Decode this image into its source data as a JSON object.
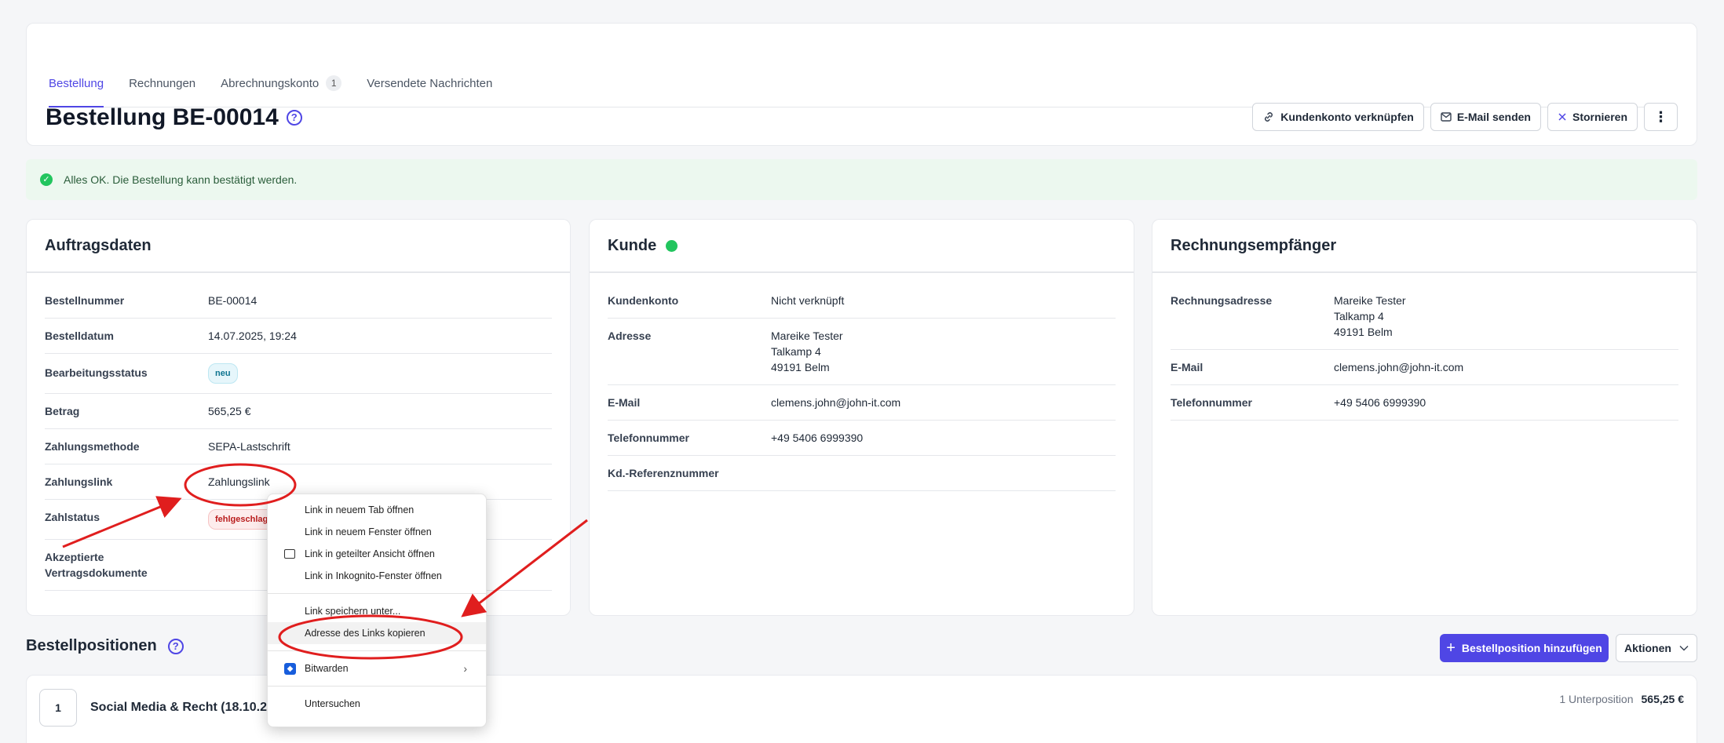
{
  "tabs": [
    {
      "label": "Bestellung"
    },
    {
      "label": "Rechnungen"
    },
    {
      "label": "Abrechnungskonto",
      "badge": "1"
    },
    {
      "label": "Versendete Nachrichten"
    }
  ],
  "header": {
    "title": "Bestellung BE-00014",
    "help": "?",
    "buttons": {
      "link": "Kundenkonto verknüpfen",
      "email": "E-Mail senden",
      "cancel": "Stornieren",
      "more": "⋮"
    }
  },
  "alert": {
    "text": "Alles OK. Die Bestellung kann bestätigt werden."
  },
  "auftrag": {
    "title": "Auftragsdaten",
    "rows": [
      {
        "k": "Bestellnummer",
        "v": "BE-00014"
      },
      {
        "k": "Bestelldatum",
        "v": "14.07.2025, 19:24"
      },
      {
        "k": "Bearbeitungsstatus",
        "v": "neu"
      },
      {
        "k": "Betrag",
        "v": "565,25 €"
      },
      {
        "k": "Zahlungsmethode",
        "v": "SEPA-Lastschrift"
      },
      {
        "k": "Zahlungslink",
        "v": "Zahlungslink"
      },
      {
        "k": "Zahlstatus",
        "v": "fehlgeschlag"
      },
      {
        "k1": "Akzeptierte",
        "k2": "Vertragsdokumente",
        "v": ""
      }
    ]
  },
  "kunde": {
    "title": "Kunde",
    "rows": [
      {
        "k": "Kundenkonto",
        "v": "Nicht verknüpft"
      },
      {
        "k": "Adresse",
        "v1": "Mareike Tester",
        "v2": "Talkamp 4",
        "v3": "49191 Belm"
      },
      {
        "k": "E-Mail",
        "v": "clemens.john@john-it.com"
      },
      {
        "k": "Telefonnummer",
        "v": "+49 5406 6999390"
      },
      {
        "k": "Kd.-Referenznummer",
        "v": ""
      }
    ]
  },
  "rechnung": {
    "title": "Rechnungsempfänger",
    "rows": [
      {
        "k": "Rechnungsadresse",
        "v1": "Mareike Tester",
        "v2": "Talkamp 4",
        "v3": "49191 Belm"
      },
      {
        "k": "E-Mail",
        "v": "clemens.john@john-it.com"
      },
      {
        "k": "Telefonnummer",
        "v": "+49 5406 6999390"
      }
    ]
  },
  "positionen": {
    "title": "Bestellpositionen",
    "add_label": "Bestellposition hinzufügen",
    "actions_label": "Aktionen",
    "item": {
      "num": "1",
      "name": "Social Media & Recht (18.10.202",
      "sub": "1 Unterposition",
      "price": "565,25 €"
    }
  },
  "context_menu": {
    "items": [
      "Link in neuem Tab öffnen",
      "Link in neuem Fenster öffnen",
      "Link in geteilter Ansicht öffnen",
      "Link in Inkognito-Fenster öffnen",
      "Link speichern unter...",
      "Adresse des Links kopieren",
      "Bitwarden",
      "Untersuchen"
    ]
  },
  "colors": {
    "accent": "#4f46e5",
    "success": "#22c55e",
    "annotation": "#e01e1e"
  }
}
